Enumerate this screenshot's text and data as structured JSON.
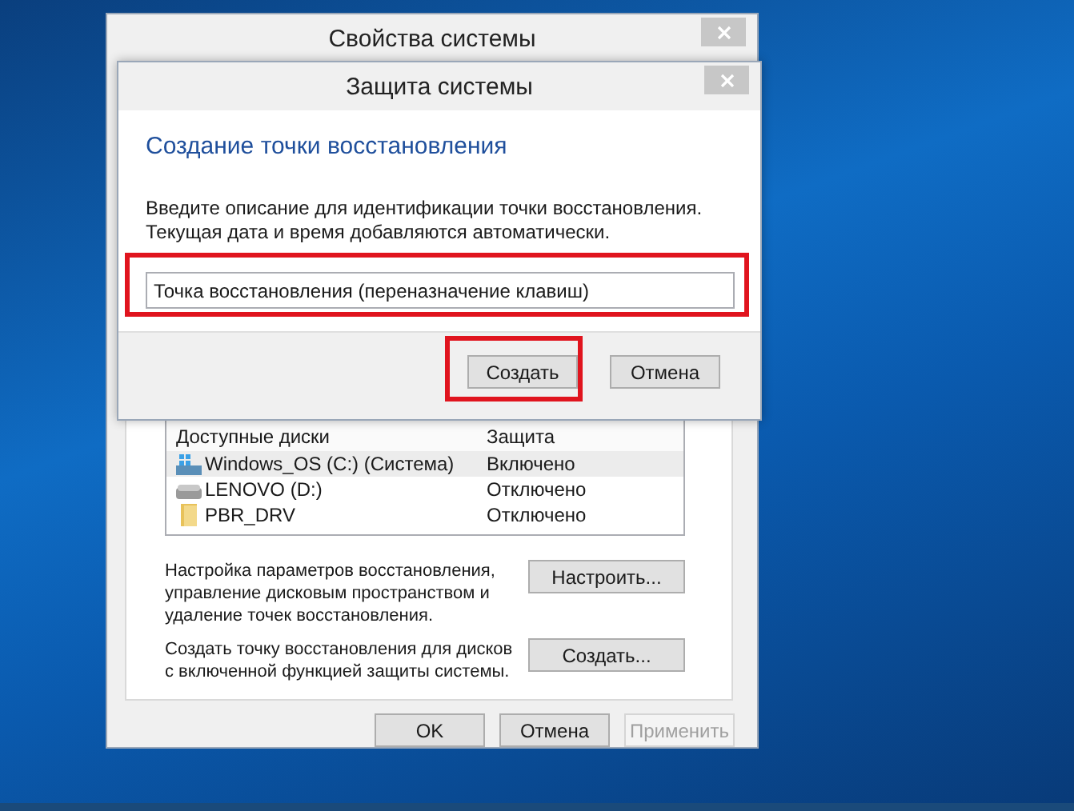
{
  "outer_window": {
    "title": "Свойства системы",
    "drives": {
      "columns": [
        "Доступные диски",
        "Защита"
      ],
      "rows": [
        {
          "kind": "system",
          "name": "Windows_OS (C:) (Система)",
          "protection": "Включено",
          "selected": true
        },
        {
          "kind": "disk",
          "name": "LENOVO (D:)",
          "protection": "Отключено",
          "selected": false
        },
        {
          "kind": "folder",
          "name": "PBR_DRV",
          "protection": "Отключено",
          "selected": false
        }
      ]
    },
    "actions": [
      {
        "text": "Настройка параметров восстановления, управление дисковым пространством и удаление точек восстановления.",
        "button": "Настроить..."
      },
      {
        "text": "Создать точку восстановления для дисков с включенной функцией защиты системы.",
        "button": "Создать..."
      }
    ],
    "buttons": [
      {
        "label": "OK",
        "disabled": false
      },
      {
        "label": "Отмена",
        "disabled": false
      },
      {
        "label": "Применить",
        "disabled": true
      }
    ]
  },
  "dialog": {
    "title": "Защита системы",
    "heading": "Создание точки восстановления",
    "description": "Введите описание для идентификации точки восстановления. Текущая дата и время добавляются автоматически.",
    "input": {
      "value": "Точка восстановления (переназначение клавиш)",
      "highlighted": true
    },
    "buttons": [
      {
        "label": "Создать",
        "highlighted": true
      },
      {
        "label": "Отмена",
        "highlighted": false
      }
    ]
  }
}
